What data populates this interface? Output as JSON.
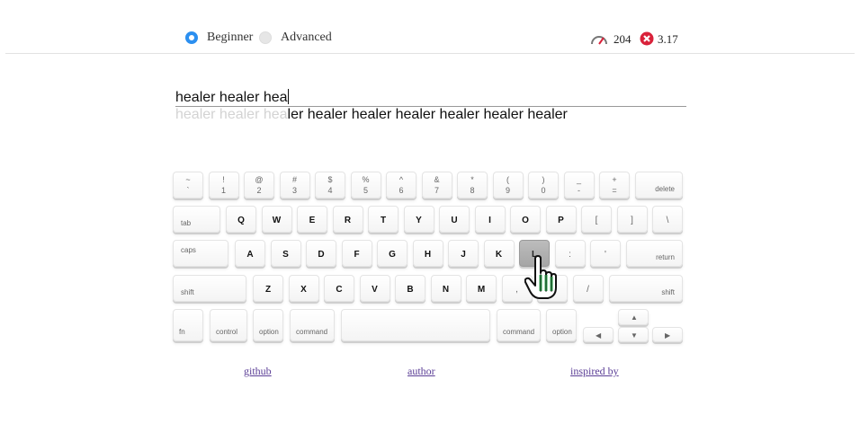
{
  "mode": {
    "beginner": "Beginner",
    "advanced": "Advanced",
    "selected": "Beginner"
  },
  "stats": {
    "speed": "204",
    "errors": "3.17",
    "speed_icon": "speedometer-icon",
    "error_icon": "error-x-icon"
  },
  "input": {
    "typed": "healer healer hea"
  },
  "target": {
    "done": "healer healer hea",
    "rest": "ler healer healer healer healer healer healer"
  },
  "keyboard": {
    "row1": [
      {
        "top": "~",
        "bot": "`"
      },
      {
        "top": "!",
        "bot": "1"
      },
      {
        "top": "@",
        "bot": "2"
      },
      {
        "top": "#",
        "bot": "3"
      },
      {
        "top": "$",
        "bot": "4"
      },
      {
        "top": "%",
        "bot": "5"
      },
      {
        "top": "^",
        "bot": "6"
      },
      {
        "top": "&",
        "bot": "7"
      },
      {
        "top": "*",
        "bot": "8"
      },
      {
        "top": "(",
        "bot": "9"
      },
      {
        "top": ")",
        "bot": "0"
      },
      {
        "top": "_",
        "bot": "-"
      },
      {
        "top": "+",
        "bot": "="
      }
    ],
    "delete": "delete",
    "tab": "tab",
    "row2": [
      "Q",
      "W",
      "E",
      "R",
      "T",
      "Y",
      "U",
      "I",
      "O",
      "P",
      "[",
      "]",
      "\\"
    ],
    "caps": "caps",
    "row3": [
      "A",
      "S",
      "D",
      "F",
      "G",
      "H",
      "J",
      "K",
      "L",
      ":",
      "'"
    ],
    "return": "return",
    "shift": "shift",
    "row4": [
      "Z",
      "X",
      "C",
      "V",
      "B",
      "N",
      "M",
      ",",
      ".",
      "/"
    ],
    "fn": "fn",
    "control": "control",
    "option": "option",
    "command": "command",
    "arrows": {
      "up": "▲",
      "left": "◀",
      "down": "▼",
      "right": "▶"
    },
    "active_key": "L",
    "hand_icon": "pointing-hand-icon"
  },
  "links": {
    "github": "github",
    "author": "author",
    "inspired": "inspired by"
  },
  "colors": {
    "radio": "#2b8ff0",
    "error": "#d9223a",
    "link": "#5b3e96",
    "hand_stripe": "#2fa84f"
  }
}
